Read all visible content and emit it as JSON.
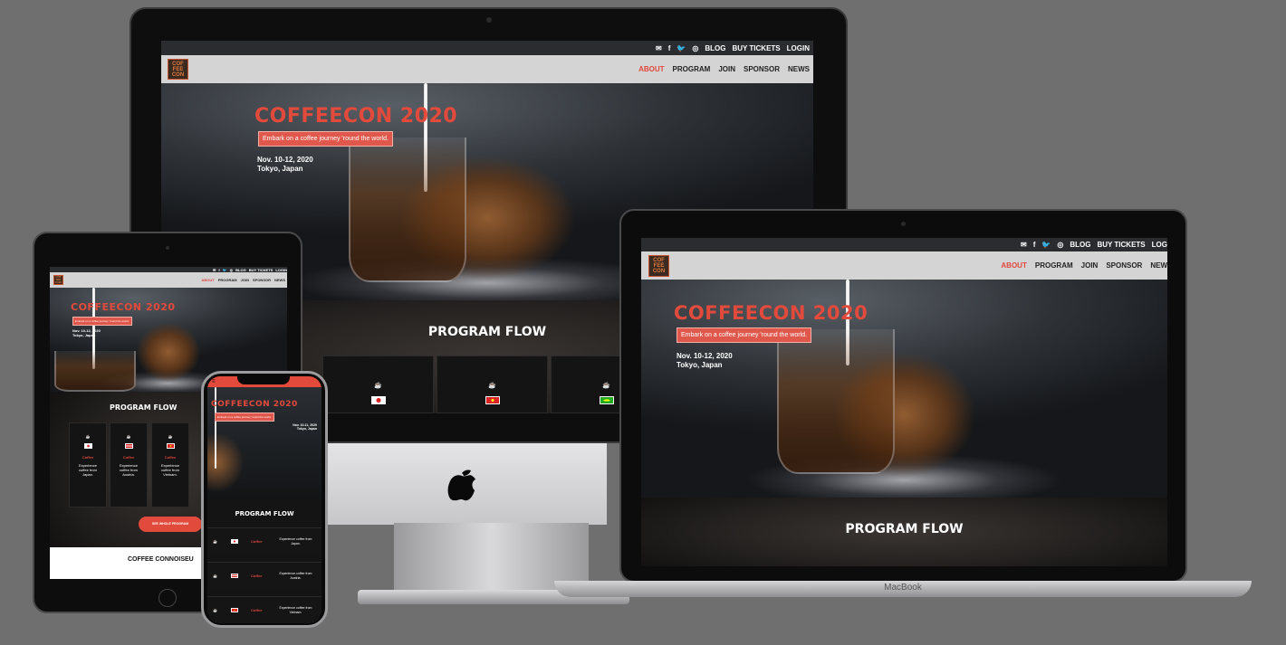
{
  "site": {
    "logo_text": [
      "COF",
      "FEE",
      "CON"
    ],
    "topbar": {
      "icons": [
        "email-icon",
        "facebook-icon",
        "twitter-icon",
        "instagram-icon"
      ],
      "links": [
        "BLOG",
        "BUY TICKETS",
        "LOGIN"
      ],
      "links_cut": [
        "BLOG",
        "BUY TICKETS",
        "LOG"
      ]
    },
    "nav": [
      "ABOUT",
      "PROGRAM",
      "JOIN",
      "SPONSOR",
      "NEWS"
    ],
    "nav_cut_last": "NEW",
    "hero": {
      "title": "COFFEECON 2020",
      "tagline": "Embark on a coffee journey 'round the world.",
      "date": "Nov. 10-12, 2020",
      "date_phone": "Nov. 10-11, 2020",
      "location": "Tokyo, Japan"
    },
    "program": {
      "heading": "PROGRAM FLOW",
      "items": [
        {
          "label": "Coffee",
          "text_tablet": "Experience coffee from Japan.",
          "text_phone": "Experience coffee from Japan."
        },
        {
          "label": "Coffee",
          "text_tablet": "Experience coffee from Austria.",
          "text_phone": "Experience coffee from Austria."
        },
        {
          "label": "Coffee",
          "text_tablet": "Experience coffee from Vietnam.",
          "text_phone": "Experience coffee from Vietnam."
        }
      ],
      "see_button": "SEE WHOLE PROGRAM"
    },
    "next_section": "COFFEE CONNOISEU",
    "accent_color": "#e2463c"
  },
  "devices": {
    "laptop_brand": "MacBook"
  }
}
